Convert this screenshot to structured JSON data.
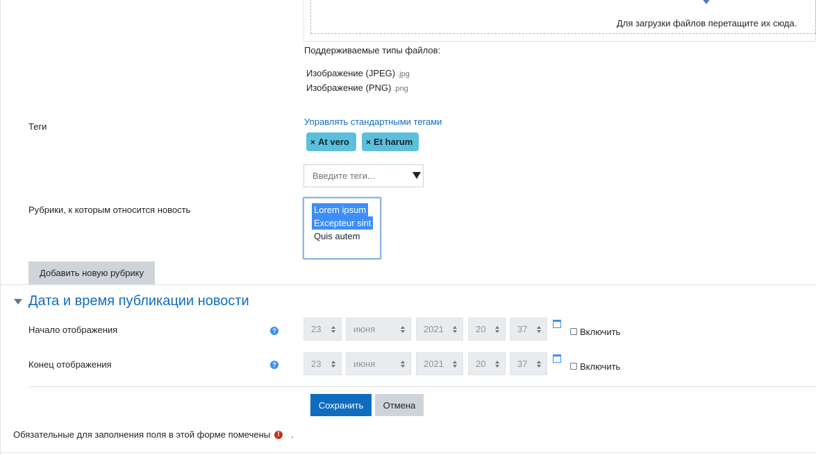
{
  "filepicker": {
    "drop_text": "Для загрузки файлов перетащите их сюда.",
    "supported_label": "Поддерживаемые типы файлов:",
    "types": [
      {
        "name": "Изображение (JPEG)",
        "ext": ".jpg"
      },
      {
        "name": "Изображение (PNG)",
        "ext": ".png"
      }
    ]
  },
  "tags": {
    "label": "Теги",
    "manage_link": "Управлять стандартными тегами",
    "items": [
      "At vero",
      "Et harum"
    ],
    "remove_glyph": "×",
    "input_placeholder": "Введите теги..."
  },
  "rubrics": {
    "label": "Рубрики, к которым относится новость",
    "options": [
      {
        "label": "Lorem ipsum",
        "selected": true
      },
      {
        "label": "Excepteur sint",
        "selected": true
      },
      {
        "label": "Quis autem",
        "selected": false
      }
    ],
    "add_button": "Добавить новую рубрику"
  },
  "publication": {
    "section_title": "Дата и время публикации новости",
    "start": {
      "label": "Начало отображения",
      "day": "23",
      "month": "июня",
      "year": "2021",
      "hour": "20",
      "minute": "37",
      "enable_label": "Включить"
    },
    "end": {
      "label": "Конец отображения",
      "day": "23",
      "month": "июня",
      "year": "2021",
      "hour": "20",
      "minute": "37",
      "enable_label": "Включить"
    }
  },
  "actions": {
    "save": "Сохранить",
    "cancel": "Отмена"
  },
  "footer": {
    "required_note": "Обязательные для заполнения поля в этой форме помечены",
    "required_icon_glyph": "!",
    "required_suffix": "."
  },
  "icons": {
    "help": "question-circle-icon",
    "calendar": "calendar-icon",
    "required": "exclamation-circle-icon",
    "section_toggle": "caret-down-icon",
    "upload": "arrow-down-icon"
  },
  "colors": {
    "link": "#0f6cbf",
    "tag": "#5bc0de",
    "primary": "#0f6cbf",
    "selected_option": "#3e8ef7",
    "required": "#ca3120"
  }
}
